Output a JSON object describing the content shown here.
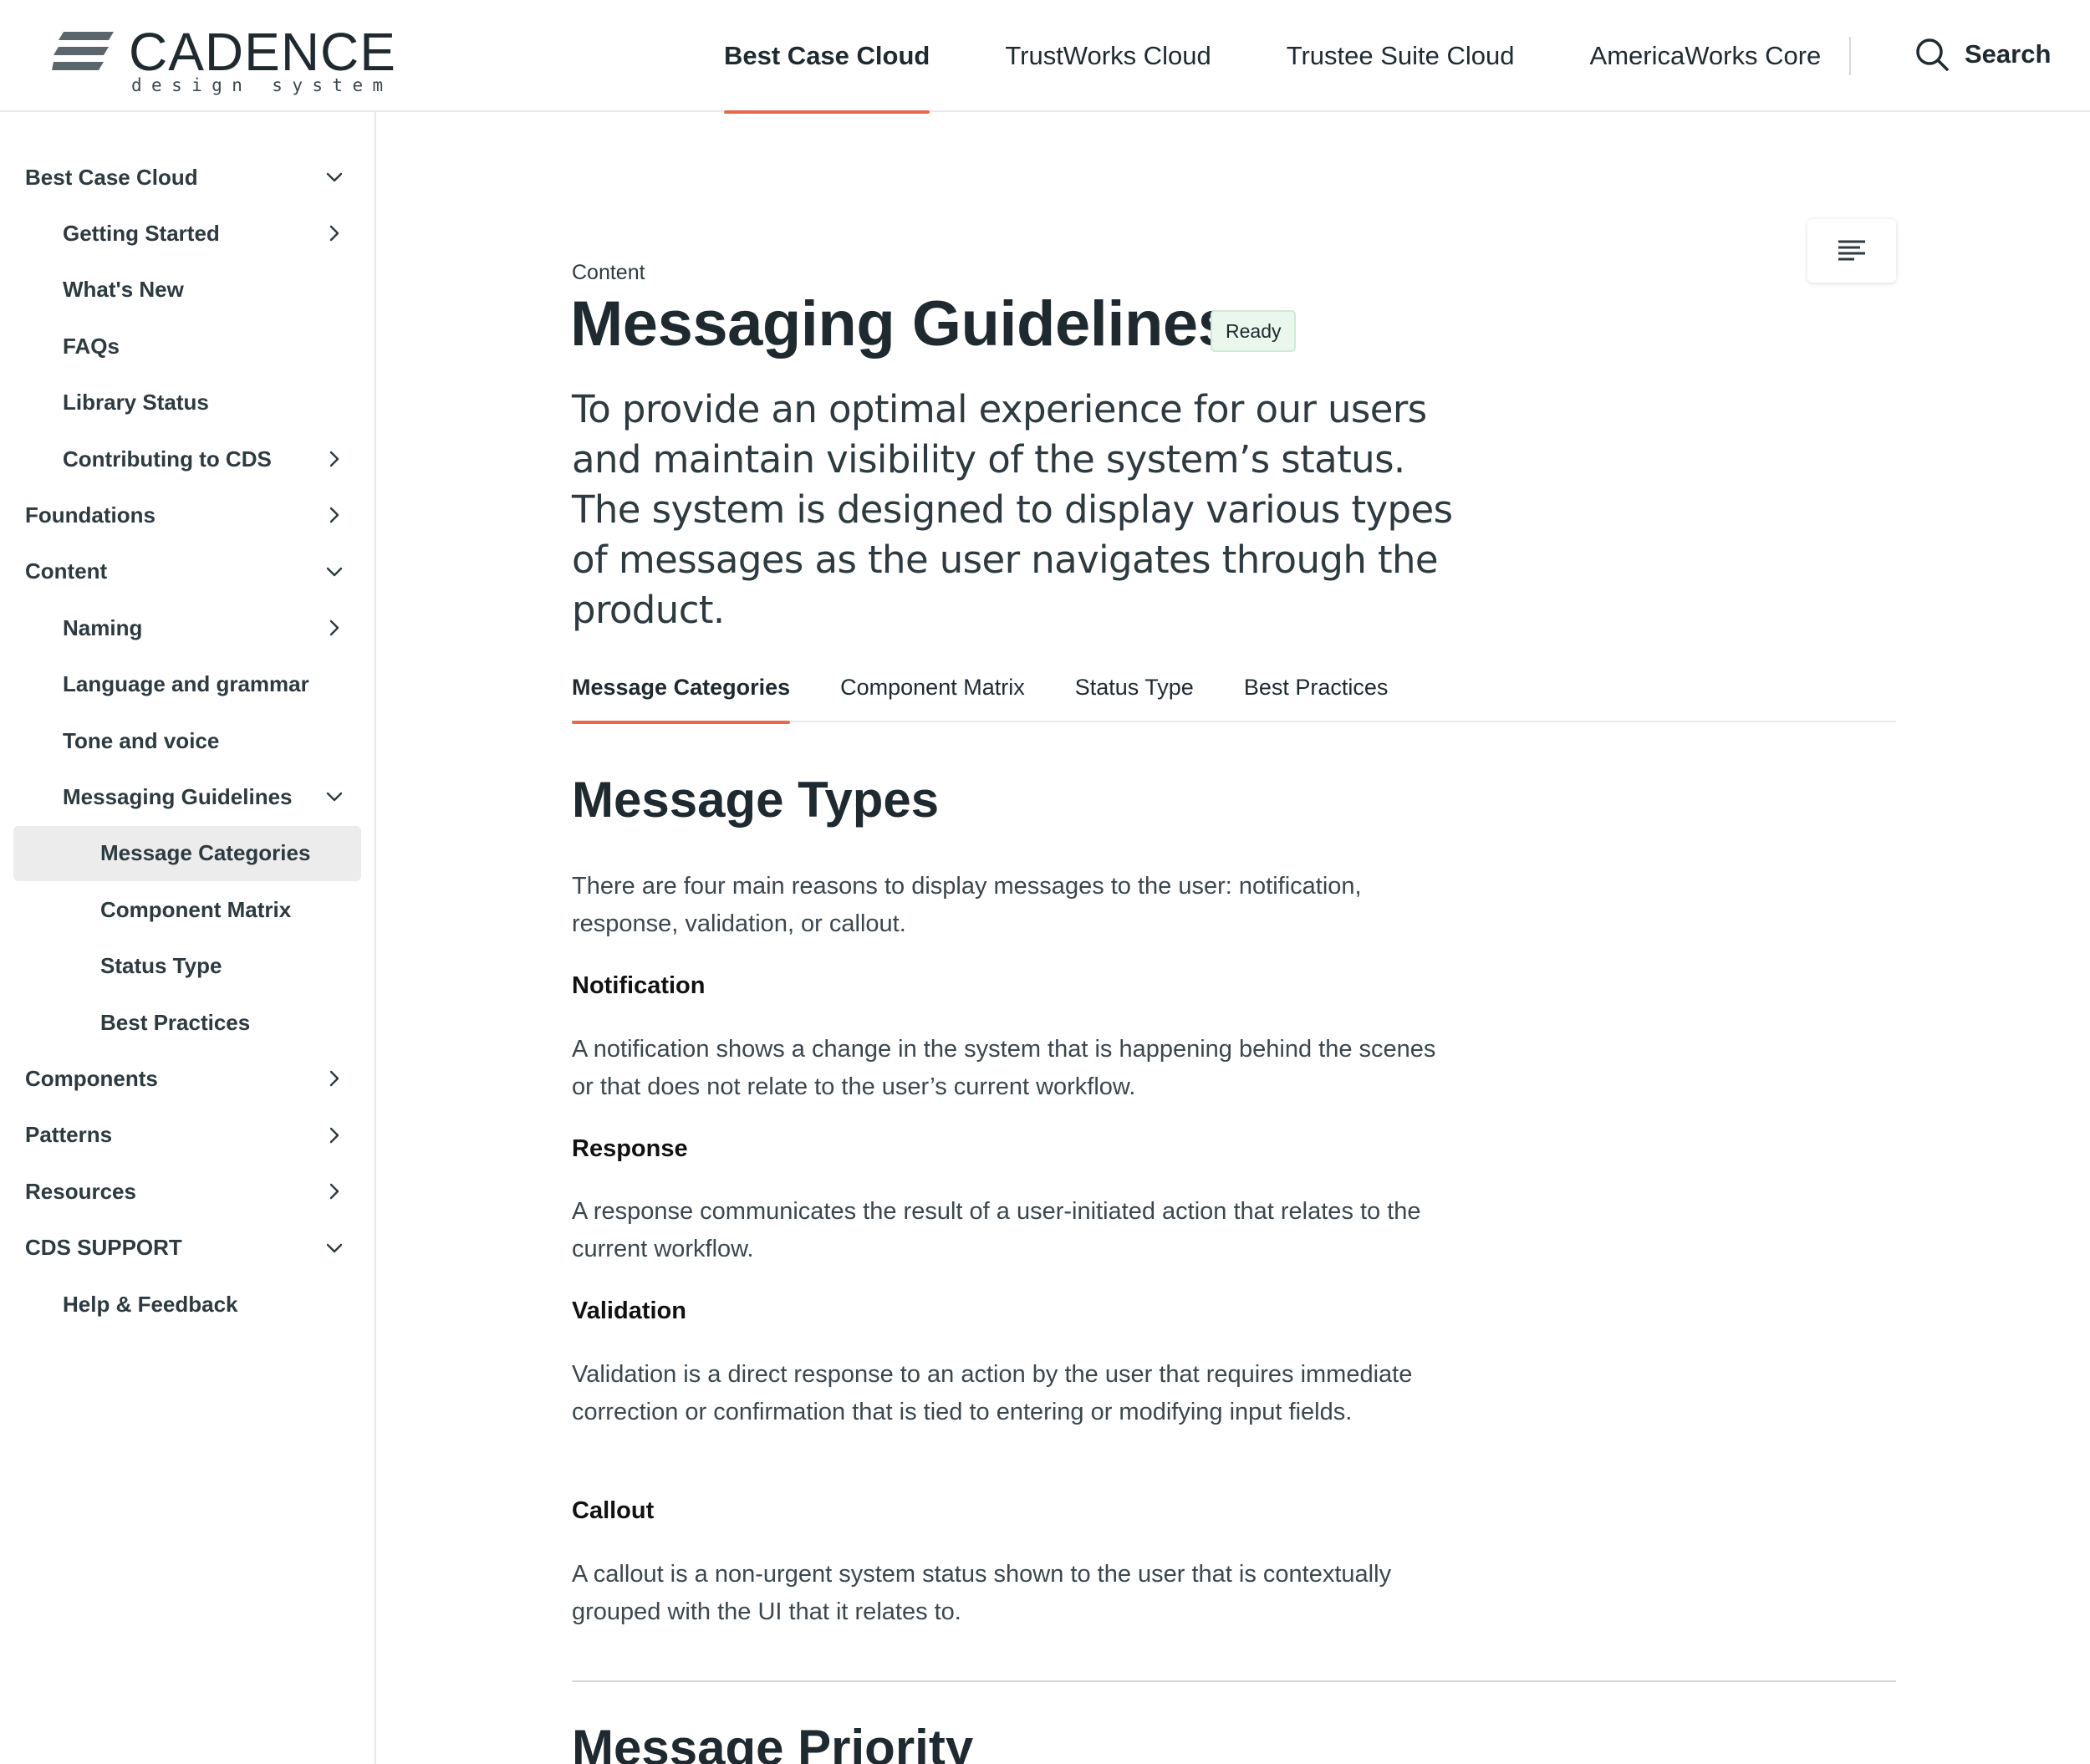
{
  "header": {
    "logo_word": "CADENCE",
    "logo_sub": "design system",
    "nav": [
      {
        "label": "Best Case Cloud",
        "active": true
      },
      {
        "label": "TrustWorks Cloud",
        "active": false
      },
      {
        "label": "Trustee Suite Cloud",
        "active": false
      },
      {
        "label": "AmericaWorks Core",
        "active": false
      }
    ],
    "search_label": "Search",
    "icons": {
      "search": "search-icon",
      "logo": "logo-stripes-icon"
    }
  },
  "sidebar": {
    "items": [
      {
        "label": "Best Case Cloud",
        "level": 0,
        "chevron": "down"
      },
      {
        "label": "Getting Started",
        "level": 1,
        "chevron": "right"
      },
      {
        "label": "What's New",
        "level": 1,
        "chevron": ""
      },
      {
        "label": "FAQs",
        "level": 1,
        "chevron": ""
      },
      {
        "label": "Library Status",
        "level": 1,
        "chevron": ""
      },
      {
        "label": "Contributing to CDS",
        "level": 1,
        "chevron": "right"
      },
      {
        "label": "Foundations",
        "level": 0,
        "chevron": "right"
      },
      {
        "label": "Content",
        "level": 0,
        "chevron": "down"
      },
      {
        "label": "Naming",
        "level": 1,
        "chevron": "right"
      },
      {
        "label": "Language and grammar",
        "level": 1,
        "chevron": ""
      },
      {
        "label": "Tone and voice",
        "level": 1,
        "chevron": ""
      },
      {
        "label": "Messaging Guidelines",
        "level": 1,
        "chevron": "down"
      },
      {
        "label": "Message Categories",
        "level": 2,
        "chevron": "",
        "selected": true
      },
      {
        "label": "Component Matrix",
        "level": 2,
        "chevron": ""
      },
      {
        "label": "Status Type",
        "level": 2,
        "chevron": ""
      },
      {
        "label": "Best Practices",
        "level": 2,
        "chevron": ""
      },
      {
        "label": "Components",
        "level": 0,
        "chevron": "right"
      },
      {
        "label": "Patterns",
        "level": 0,
        "chevron": "right"
      },
      {
        "label": "Resources",
        "level": 0,
        "chevron": "right"
      },
      {
        "label": "CDS SUPPORT",
        "level": 0,
        "chevron": "down"
      },
      {
        "label": "Help & Feedback",
        "level": 1,
        "chevron": ""
      }
    ]
  },
  "page": {
    "eyebrow": "Content",
    "title": "Messaging Guidelines",
    "status": "Ready",
    "intro": "To provide an optimal experience for our users and maintain visibility of the system’s status. The system is designed to display various types of messages as the user navigates through the product.",
    "toc_icon": "table-of-contents-icon",
    "tabs": [
      {
        "label": "Message Categories",
        "active": true
      },
      {
        "label": "Component Matrix",
        "active": false
      },
      {
        "label": "Status Type",
        "active": false
      },
      {
        "label": "Best Practices",
        "active": false
      }
    ]
  },
  "content": {
    "section_title": "Message Types",
    "lead": "There are four main reasons to display messages to the user: notification, response, validation, or callout.",
    "types": [
      {
        "heading": "Notification",
        "body": "A notification shows a change in the system that is happening behind the scenes or that does not relate to the user’s current workflow."
      },
      {
        "heading": "Response",
        "body": "A response communicates the result of a user-initiated action that relates to the current workflow."
      },
      {
        "heading": "Validation",
        "body": "Validation is a direct response to an action by the user that requires immediate correction or confirmation that is tied to entering or modifying input fields."
      },
      {
        "heading": "Callout",
        "body": "A callout is a non-urgent system status shown to the user that is contextually grouped with the UI that it relates to."
      }
    ],
    "next_section_title": "Message Priority"
  },
  "colors": {
    "accent": "#e8684c",
    "text": "#1f2a30",
    "badge_bg": "#eaf7ed",
    "selected_bg": "#ececec"
  }
}
